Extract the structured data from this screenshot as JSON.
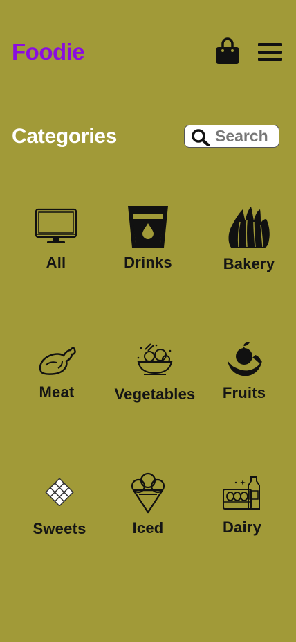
{
  "header": {
    "logo": "Foodie",
    "cart_icon": "shopping-bag-icon",
    "menu_icon": "hamburger-menu-icon"
  },
  "categories_section": {
    "title": "Categories",
    "search": {
      "placeholder": "Search",
      "value": ""
    }
  },
  "categories": [
    {
      "label": "All",
      "icon": "monitor-icon"
    },
    {
      "label": "Drinks",
      "icon": "drink-glass-icon"
    },
    {
      "label": "Bakery",
      "icon": "bread-icon"
    },
    {
      "label": "Meat",
      "icon": "chicken-leg-icon"
    },
    {
      "label": "Vegetables",
      "icon": "salad-bowl-icon"
    },
    {
      "label": "Fruits",
      "icon": "fruit-basket-icon"
    },
    {
      "label": "Sweets",
      "icon": "chocolate-icon"
    },
    {
      "label": "Iced",
      "icon": "ice-cream-icon"
    },
    {
      "label": "Dairy",
      "icon": "dairy-eggs-milk-icon"
    }
  ],
  "colors": {
    "background": "#a19a38",
    "brand": "#8a0de0",
    "title": "#ffffff",
    "text": "#151515"
  }
}
